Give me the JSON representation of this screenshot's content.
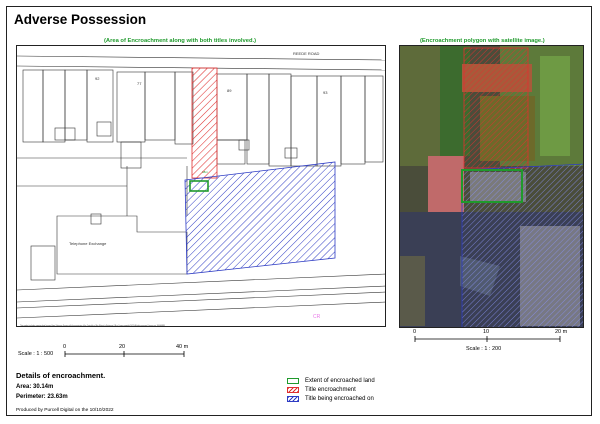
{
  "title": "Adverse Possession",
  "left_map": {
    "caption": "(Area of Encroachment along with both titles involved.)",
    "road_label": "REEDE ROAD",
    "building_label": "Telephone Exchange",
    "house_numbers": [
      "92",
      "77",
      "89",
      "93"
    ],
    "plot_label": "38m",
    "area_label": "CR",
    "copyright": "This product includes mapping data licensed from Ordnance Survey with the permission of the Controller of Her Majesty's Stationery Office Crown copyright 2022. All rights reserved. Licence no. 100040889",
    "scale": {
      "ticks": [
        "0",
        "20",
        "40 m"
      ],
      "label": "Scale : 1 : 500"
    }
  },
  "right_map": {
    "caption": "(Encroachment polygon with satellite image.)",
    "scale": {
      "ticks": [
        "0",
        "10",
        "20 m"
      ],
      "label": "Scale : 1 : 200"
    }
  },
  "details": {
    "heading": "Details of encroachment.",
    "area": "Area: 30.14m",
    "perimeter": "Perimeter: 23.63m"
  },
  "legend": [
    {
      "label": "Extent of encroached land",
      "color": "#1f9a2c",
      "style": "solid-outline"
    },
    {
      "label": "Title encroachment",
      "color": "#e03030",
      "style": "hatched"
    },
    {
      "label": "Title being encroached on",
      "color": "#2e3cc4",
      "style": "hatched"
    }
  ],
  "footer": "Produced by Purcell Digital on the 10/10/2022"
}
